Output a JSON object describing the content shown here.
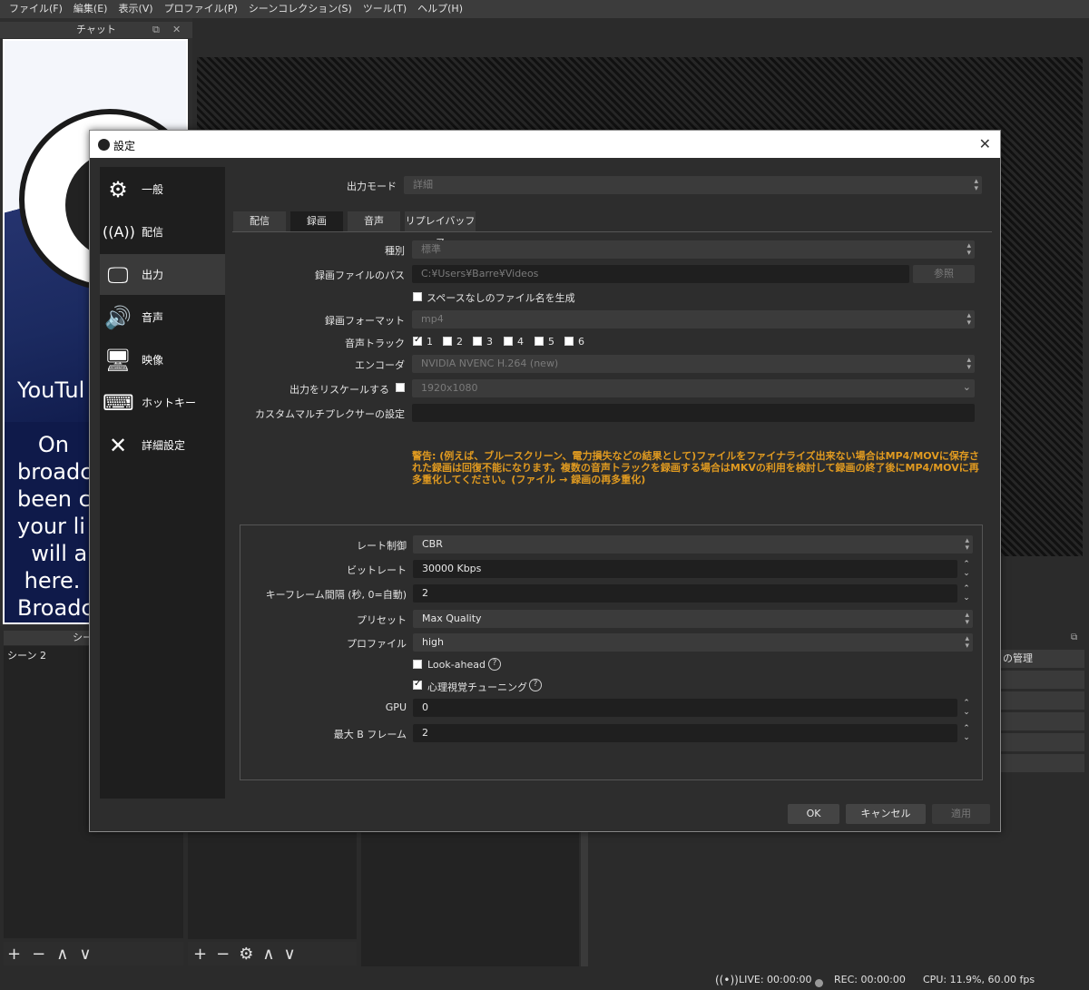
{
  "menubar": {
    "items": [
      "ファイル(F)",
      "編集(E)",
      "表示(V)",
      "プロファイル(P)",
      "シーンコレクション(S)",
      "ツール(T)",
      "ヘルプ(H)"
    ]
  },
  "chat_dock": {
    "title": "チャット",
    "content_text": "YouTul\n\n   On\nbroadc\nbeen c\nyour li\n  will a\n here.\nBroadc\n not sur"
  },
  "scene_dock": {
    "title": "シー",
    "scene_item": "シーン 2"
  },
  "right_dock": {
    "item_label": "の管理"
  },
  "statusbar": {
    "live": "LIVE: 00:00:00",
    "rec": "REC: 00:00:00",
    "cpu": "CPU: 11.9%, 60.00 fps"
  },
  "dialog": {
    "title": "設定",
    "sidebar": [
      {
        "label": "一般",
        "icon": "gear-icon"
      },
      {
        "label": "配信",
        "icon": "antenna-icon"
      },
      {
        "label": "出力",
        "icon": "monitor-output-icon"
      },
      {
        "label": "音声",
        "icon": "speaker-icon"
      },
      {
        "label": "映像",
        "icon": "monitor-icon"
      },
      {
        "label": "ホットキー",
        "icon": "keyboard-icon"
      },
      {
        "label": "詳細設定",
        "icon": "tools-icon"
      }
    ],
    "output_mode_label": "出力モード",
    "output_mode_value": "詳細",
    "tabs": [
      "配信",
      "録画",
      "音声",
      "リプレイバッファ"
    ],
    "type_label": "種別",
    "type_value": "標準",
    "path_label": "録画ファイルのパス",
    "path_value": "C:¥Users¥Barre¥Videos",
    "browse_button": "参照",
    "no_space_label": "スペースなしのファイル名を生成",
    "format_label": "録画フォーマット",
    "format_value": "mp4",
    "audio_track_label": "音声トラック",
    "tracks": [
      "1",
      "2",
      "3",
      "4",
      "5",
      "6"
    ],
    "encoder_label": "エンコーダ",
    "encoder_value": "NVIDIA NVENC H.264 (new)",
    "rescale_label": "出力をリスケールする",
    "rescale_value": "1920x1080",
    "muxer_label": "カスタムマルチプレクサーの設定",
    "warning": "警告: (例えば、ブルースクリーン、電力損失などの結果として)ファイルをファイナライズ出来ない場合はMP4/MOVに保存された録画は回復不能になります。複数の音声トラックを録画する場合はMKVの利用を検討して録画の終了後にMP4/MOVに再多重化してください。(ファイル → 録画の再多重化)",
    "rate_control_label": "レート制御",
    "rate_control_value": "CBR",
    "bitrate_label": "ビットレート",
    "bitrate_value": "30000 Kbps",
    "keyframe_label": "キーフレーム間隔 (秒, 0=自動)",
    "keyframe_value": "2",
    "preset_label": "プリセット",
    "preset_value": "Max Quality",
    "profile_label": "プロファイル",
    "profile_value": "high",
    "lookahead_label": "Look-ahead",
    "psycho_label": "心理視覚チューニング",
    "gpu_label": "GPU",
    "gpu_value": "0",
    "bframes_label": "最大 B フレーム",
    "bframes_value": "2",
    "ok_button": "OK",
    "cancel_button": "キャンセル",
    "apply_button": "適用"
  }
}
